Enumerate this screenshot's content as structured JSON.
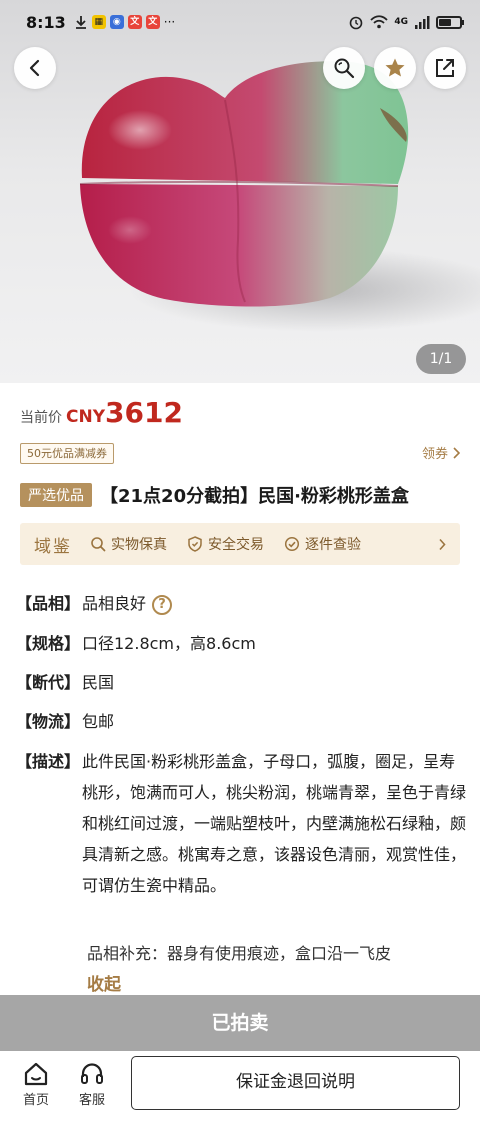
{
  "status_bar": {
    "time": "8:13",
    "network": "4G",
    "battery_level": 0.6,
    "icons": [
      "download-icon",
      "app-icon",
      "app-icon",
      "app-icon",
      "app-icon",
      "more-dots-icon",
      "alarm-icon",
      "wifi-icon",
      "signal-icon",
      "battery-icon"
    ],
    "more": "···"
  },
  "header": {
    "back_icon": "back-arrow-icon",
    "actions": [
      "search-icon",
      "star-icon",
      "share-icon"
    ]
  },
  "gallery": {
    "counter": "1/1",
    "subject": "peach-shaped lidded box"
  },
  "price": {
    "label": "当前价",
    "currency": "CNY",
    "value": "3612",
    "color": "#c0281e"
  },
  "coupon": {
    "tag": "50元优品满减券",
    "link": "领券"
  },
  "title": {
    "badge": "严选优品",
    "text": "【21点20分截拍】民国·粉彩桃形盖盒"
  },
  "guarantees": {
    "brand": "域鉴",
    "items": [
      {
        "icon": "search-icon",
        "label": "实物保真"
      },
      {
        "icon": "shield-icon",
        "label": "安全交易"
      },
      {
        "icon": "check-circle-icon",
        "label": "逐件查验"
      }
    ]
  },
  "attributes": [
    {
      "key": "【品相】",
      "value": "品相良好"
    },
    {
      "key": "【规格】",
      "value": "口径12.8cm，高8.6cm"
    },
    {
      "key": "【断代】",
      "value": "民国"
    },
    {
      "key": "【物流】",
      "value": "包邮"
    },
    {
      "key": "【描述】",
      "value": "此件民国·粉彩桃形盖盒，子母口，弧腹，圈足，呈寿桃形，饱满而可人，桃尖粉润，桃端青翠，呈色于青绿和桃红间过渡，一端贴塑枝叶，内壁满施松石绿釉，颇具清新之感。桃寓寿之意，该器设色清丽，观赏性佳，可谓仿生瓷中精品。"
    }
  ],
  "supplement": "品相补充：器身有使用痕迹，盒口沿一飞皮",
  "collapse_label": "收起",
  "sold_label": "已拍卖",
  "bottom_nav": {
    "home": "首页",
    "service": "客服",
    "deposit": "保证金退回说明"
  },
  "colors": {
    "accent": "#b5915d",
    "strip_bg": "#f8efe0",
    "sold_bar": "#a6a6a6"
  }
}
